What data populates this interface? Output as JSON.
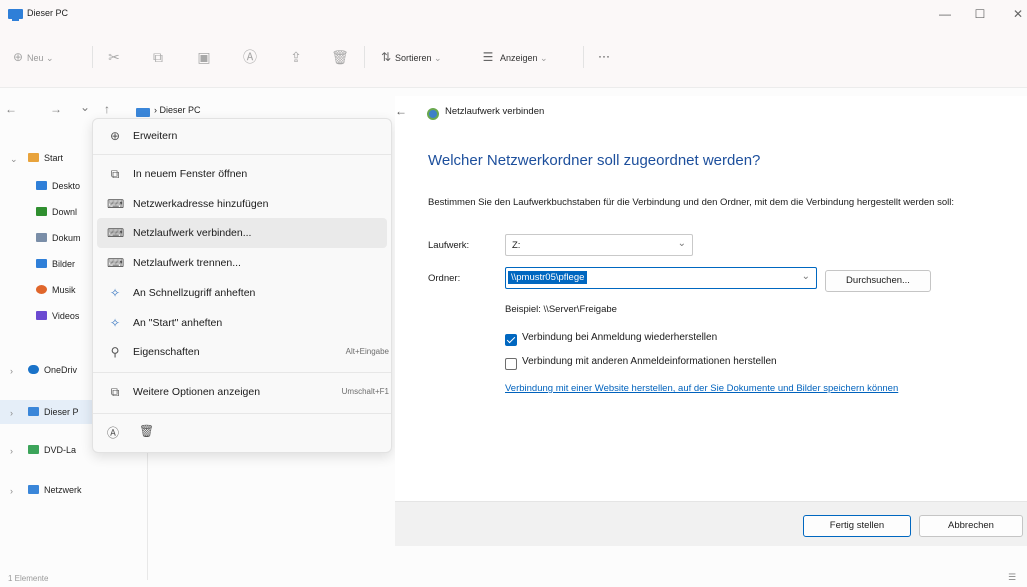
{
  "window": {
    "title": "Dieser PC",
    "minimize": "—",
    "maximize": "☐",
    "close": "✕"
  },
  "toolbar": {
    "new_label": "Neu",
    "sort_label": "Sortieren",
    "view_label": "Anzeigen",
    "more_label": "···"
  },
  "nav": {
    "back": "←",
    "forward": "→",
    "recent": "⌄",
    "up": "↑",
    "breadcrumb": "› Dieser PC"
  },
  "sidebar": {
    "items": [
      {
        "label": "Start"
      },
      {
        "label": "Deskto"
      },
      {
        "label": "Downl"
      },
      {
        "label": "Dokum"
      },
      {
        "label": "Bilder"
      },
      {
        "label": "Musik"
      },
      {
        "label": "Videos"
      },
      {
        "label": "OneDriv"
      },
      {
        "label": "Dieser P"
      },
      {
        "label": "DVD-La"
      },
      {
        "label": "Netzwerk"
      }
    ],
    "colors": {
      "start": "#e8a33c",
      "desktop": "#2f7fd8",
      "downloads": "#2f8f2f",
      "documents": "#7a8ea8",
      "pictures": "#2f7fd8",
      "music": "#e0662b",
      "videos": "#6b4ad1",
      "onedrive": "#1a73c9",
      "thispc": "#3a86d9",
      "dvd": "#3ca45a",
      "network": "#3a86d9"
    }
  },
  "context_menu": {
    "items": [
      {
        "icon": "⊕",
        "label": "Erweitern",
        "accel": ""
      },
      {
        "icon": "⧉",
        "label": "In neuem Fenster öffnen",
        "accel": ""
      },
      {
        "icon": "⌨",
        "label": "Netzwerkadresse hinzufügen",
        "accel": ""
      },
      {
        "icon": "⌨",
        "label": "Netzlaufwerk verbinden...",
        "accel": ""
      },
      {
        "icon": "⌨",
        "label": "Netzlaufwerk trennen...",
        "accel": ""
      },
      {
        "icon": "✧",
        "label": "An Schnellzugriff anheften",
        "accel": ""
      },
      {
        "icon": "✧",
        "label": "An \"Start\" anheften",
        "accel": ""
      },
      {
        "icon": "⚲",
        "label": "Eigenschaften",
        "accel": "Alt+Eingabe"
      },
      {
        "icon": "⧉",
        "label": "Weitere Optionen anzeigen",
        "accel": "Umschalt+F1"
      }
    ]
  },
  "dialog": {
    "back": "←",
    "window_title": "Netzlaufwerk verbinden",
    "heading": "Welcher Netzwerkordner soll zugeordnet werden?",
    "description": "Bestimmen Sie den Laufwerkbuchstaben für die Verbindung und den Ordner, mit dem die Verbindung hergestellt werden soll:",
    "drive_label": "Laufwerk:",
    "drive_value": "Z:",
    "folder_label": "Ordner:",
    "folder_value": "\\\\pmustr05\\pflege",
    "browse_label": "Durchsuchen...",
    "example": "Beispiel: \\\\Server\\Freigabe",
    "reconnect_label": "Verbindung bei Anmeldung wiederherstellen",
    "reconnect_checked": true,
    "other_creds_label": "Verbindung mit anderen Anmeldeinformationen herstellen",
    "other_creds_checked": false,
    "website_link": "Verbindung mit einer Website herstellen, auf der Sie Dokumente und Bilder speichern können",
    "finish_label": "Fertig stellen",
    "cancel_label": "Abbrechen"
  },
  "status": {
    "count_text": "1 Elemente"
  }
}
